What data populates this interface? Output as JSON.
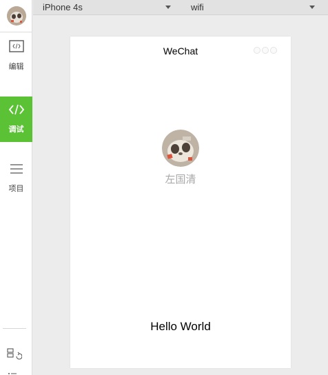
{
  "sidebar": {
    "items": [
      {
        "label": "编辑",
        "icon": "code-editor-icon",
        "active": false
      },
      {
        "label": "调试",
        "icon": "code-brackets-icon",
        "active": true
      },
      {
        "label": "项目",
        "icon": "menu-lines-icon",
        "active": false
      }
    ],
    "bottom_icons": [
      "project-settings-icon",
      "list-icon"
    ]
  },
  "toolbar": {
    "device_select": "iPhone 4s",
    "network_select": "wifi"
  },
  "phone": {
    "nav_title": "WeChat",
    "user_name": "左国清",
    "hello_text": "Hello World"
  },
  "colors": {
    "accent": "#5bc135",
    "sidebar_bg": "#ffffff",
    "toolbar_bg": "#e2e2e2",
    "canvas_bg": "#ececec",
    "user_name": "#a8a8a8"
  }
}
